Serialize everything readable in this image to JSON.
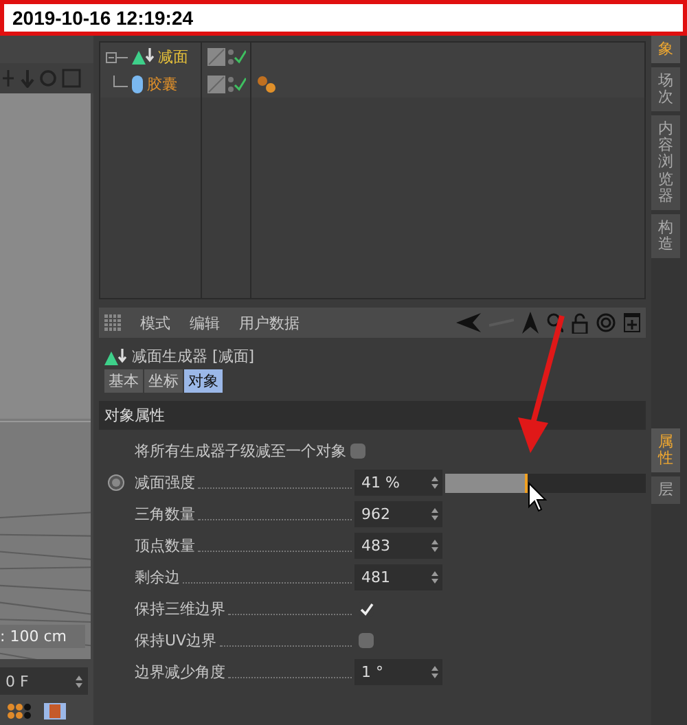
{
  "timestamp": "2019-10-16 12:19:24",
  "viewport": {
    "scale_label": ": 100 cm",
    "frame_field": "0 F"
  },
  "objects": [
    {
      "name": "减面",
      "color": "#e8c23a",
      "kind": "generator",
      "tags": false
    },
    {
      "name": "胶囊",
      "color": "#e0902a",
      "kind": "capsule",
      "tags": true
    }
  ],
  "attributes": {
    "menu": [
      "模式",
      "编辑",
      "用户数据"
    ],
    "title": "减面生成器 [减面]",
    "tabs": [
      {
        "label": "基本",
        "selected": false
      },
      {
        "label": "坐标",
        "selected": false
      },
      {
        "label": "对象",
        "selected": true
      }
    ],
    "section": "对象属性",
    "rows": [
      {
        "kind": "checkbox",
        "label": "将所有生成器子级减至一个对象",
        "checked": false
      },
      {
        "kind": "slider",
        "label": "减面强度",
        "value": "41 %",
        "level": 0.41
      },
      {
        "kind": "number",
        "label": "三角数量",
        "value": "962"
      },
      {
        "kind": "number",
        "label": "顶点数量",
        "value": "483"
      },
      {
        "kind": "number",
        "label": "剩余边",
        "value": "481"
      },
      {
        "kind": "checkbox",
        "label": "保持三维边界",
        "checked": true
      },
      {
        "kind": "checkbox",
        "label": "保持UV边界",
        "checked": false
      },
      {
        "kind": "number",
        "label": "边界减少角度",
        "value": "1 °"
      }
    ]
  },
  "side_tabs": [
    {
      "label": "象",
      "selected": true
    },
    {
      "label": "场次",
      "selected": false
    },
    {
      "label": "内容浏览器",
      "selected": false
    },
    {
      "label": "构造",
      "selected": false
    },
    {
      "label": "属性",
      "selected": true
    },
    {
      "label": "层",
      "selected": false
    }
  ]
}
